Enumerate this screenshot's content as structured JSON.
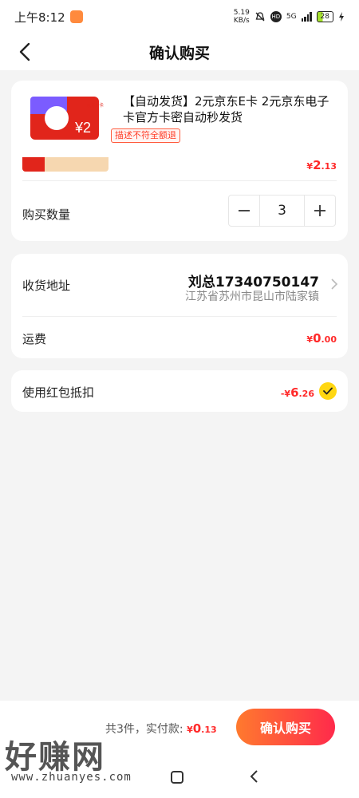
{
  "status_bar": {
    "time": "上午8:12",
    "net_speed_value": "5.19",
    "net_speed_unit": "KB/s",
    "hd": "HD",
    "network": "5G",
    "battery": "28"
  },
  "nav": {
    "title": "确认购买"
  },
  "product": {
    "title": "【自动发货】2元京东E卡 2元京东电子卡官方卡密自动秒发货",
    "badge": "描述不符全额退",
    "price_symbol": "¥",
    "price_int": "2",
    "price_dec": ".13",
    "image_value": "¥2",
    "image_label": "京东E卡"
  },
  "quantity": {
    "label": "购买数量",
    "value": "3",
    "minus": "−",
    "plus": "+"
  },
  "address": {
    "label": "收货地址",
    "name_phone": "刘总17340750147",
    "detail": "江苏省苏州市昆山市陆家镇"
  },
  "shipping": {
    "label": "运费",
    "symbol": "¥",
    "int": "0",
    "dec": ".00"
  },
  "coupon": {
    "label": "使用红包抵扣",
    "prefix": "-¥",
    "int": "6",
    "dec": ".26",
    "checked": true
  },
  "footer": {
    "summary": "共3件，实付款:",
    "amount_symbol": "¥",
    "amount_int": "0",
    "amount_dec": ".13",
    "confirm_label": "确认购买"
  },
  "watermark": {
    "text": "好赚网",
    "url": "www.zhuanyes.com"
  },
  "colors": {
    "price_red": "#ff2a2a",
    "accent_yellow": "#ffd712",
    "button_start": "#ff7a2e",
    "button_end": "#ff2a4b"
  }
}
